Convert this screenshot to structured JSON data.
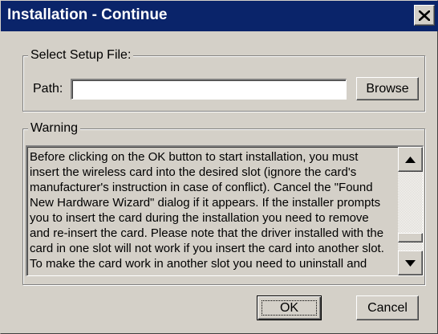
{
  "window": {
    "title": "Installation - Continue",
    "close_icon": "close-icon"
  },
  "setup_group": {
    "legend": "Select Setup File:",
    "path_label": "Path:",
    "path_value": "",
    "browse_label": "Browse"
  },
  "warning_group": {
    "legend": "Warning",
    "text": "Before clicking on the OK button to start installation, you must\ninsert the wireless card into the desired slot (ignore the card's\nmanufacturer's instruction in case of conflict). Cancel the \"Found\nNew Hardware Wizard\" dialog if it appears. If the installer prompts\nyou to insert the card during the installation you need to remove\nand re-insert the card. Please note that the driver installed with the\ncard in one slot will not work if you insert the card into another slot.\nTo make the card work in another slot you need to uninstall and",
    "scroll_position": 0.88
  },
  "buttons": {
    "ok_label": "OK",
    "cancel_label": "Cancel"
  },
  "colors": {
    "titlebar": "#0a246a",
    "face": "#d4d0c8"
  }
}
